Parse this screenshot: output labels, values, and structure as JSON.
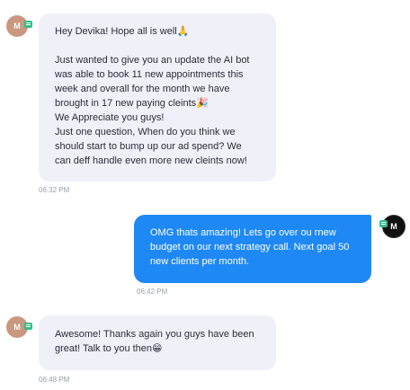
{
  "conversation": {
    "messages": [
      {
        "direction": "inbound",
        "avatar_initial": "M",
        "text": "Hey Devika! Hope all is well🙏\n\nJust wanted to give you an update the AI bot was able to book 11 new appointments this week and overall for the month we have brought in 17 new paying cleints🎉\nWe Appreciate you guys!\nJust one question, When do you think we should start to bump up our ad spend? We can deff handle even more new cleints now!",
        "time": "06:32 PM"
      },
      {
        "direction": "outbound",
        "avatar_initial": "M",
        "text": "OMG thats amazing! Lets go over ou rnew budget on our next strategy call. Next goal 50 new clients per month.",
        "time": "06:42 PM"
      },
      {
        "direction": "inbound",
        "avatar_initial": "M",
        "text": "Awesome! Thanks again you guys have been great! Talk to you then😁",
        "time": "06:48 PM"
      }
    ]
  },
  "colors": {
    "inbound_bubble": "#f0f1f8",
    "outbound_bubble": "#1e88f5",
    "timestamp": "#9aa0ab",
    "channel_badge": "#2fbf8a"
  },
  "icons": [
    "sms-channel-icon"
  ]
}
